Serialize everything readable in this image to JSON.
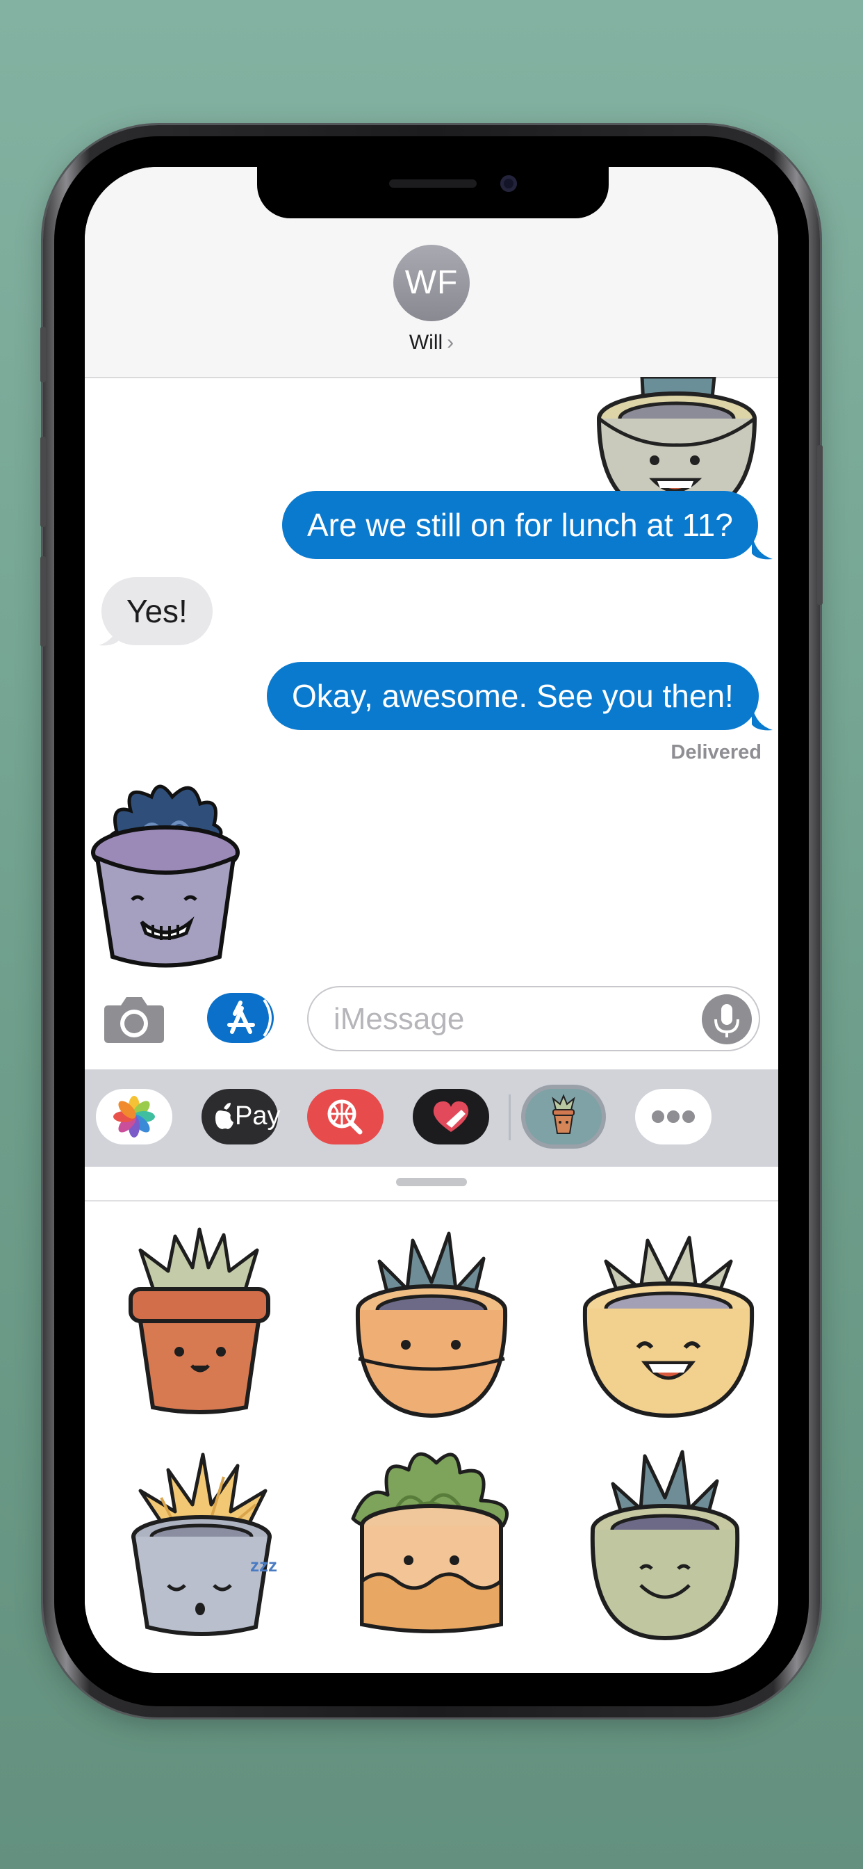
{
  "conversation": {
    "contact_initials": "WF",
    "contact_name": "Will",
    "chevron": "›"
  },
  "messages": [
    {
      "direction": "out",
      "text": "Are we still on for lunch at 11?"
    },
    {
      "direction": "in",
      "text": "Yes!"
    },
    {
      "direction": "out",
      "text": "Okay, awesome. See you then!"
    }
  ],
  "delivery_status": "Delivered",
  "compose": {
    "placeholder": "iMessage",
    "camera_icon": "camera-icon",
    "app_store_icon": "app-store-icon",
    "mic_icon": "microphone-icon"
  },
  "app_drawer": {
    "apps": [
      {
        "name": "photos",
        "icon": "photos-icon"
      },
      {
        "name": "apple-pay",
        "label": "Pay",
        "icon": "apple-pay-icon"
      },
      {
        "name": "image-search",
        "icon": "globe-search-icon"
      },
      {
        "name": "digital-touch",
        "icon": "heart-touch-icon"
      },
      {
        "name": "succulent-stickers",
        "icon": "succulent-sticker-icon",
        "selected": true
      },
      {
        "name": "more",
        "icon": "more-icon"
      }
    ]
  },
  "sticker_pack": {
    "stickers": [
      "terracotta-pot-smiling",
      "orange-bowl-pot-neutral",
      "yellow-bowl-pot-laughing",
      "gray-pot-sleeping",
      "peach-pot-succulent",
      "green-bowl-pot-smiling"
    ]
  },
  "colors": {
    "imessage_blue": "#0a7acf",
    "received_bubble": "#e8e8ea",
    "background": "#84b2a2"
  }
}
